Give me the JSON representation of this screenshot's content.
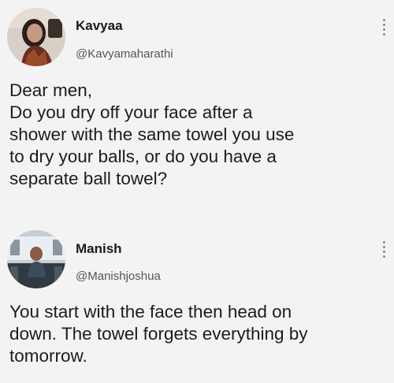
{
  "posts": [
    {
      "author_name": "Kavyaa",
      "author_handle": "@Kavyamaharathi",
      "text": "Dear men,\nDo you dry off your face after a\nshower with the same towel you use\nto dry your balls, or do you have a\nseparate ball towel?"
    },
    {
      "author_name": "Manish",
      "author_handle": "@Manishjoshua",
      "text": "You start with the face then head on\ndown. The towel forgets everything by\ntomorrow."
    }
  ],
  "icons": {
    "menu": "more-vertical-icon",
    "avatar_1": "profile-photo",
    "avatar_2": "profile-photo"
  }
}
